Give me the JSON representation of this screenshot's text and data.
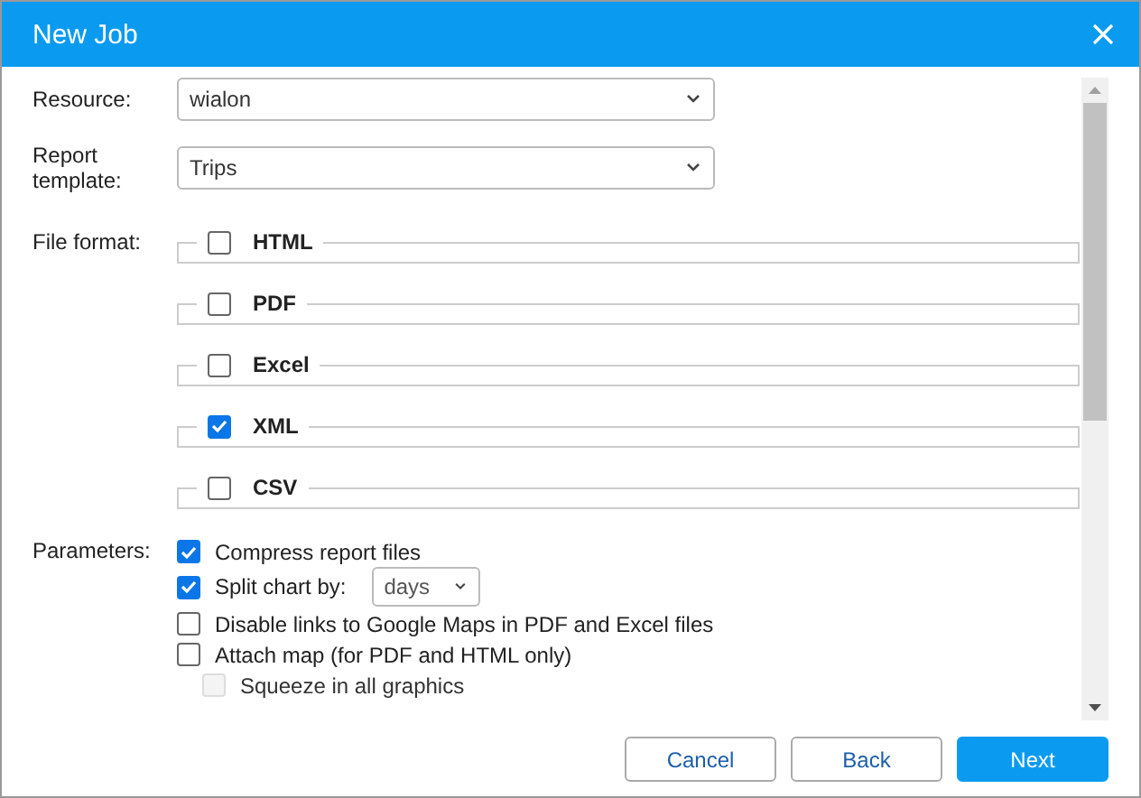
{
  "window": {
    "title": "New Job"
  },
  "resource": {
    "label": "Resource:",
    "value": "wialon"
  },
  "report_template": {
    "label": "Report template:",
    "value": "Trips"
  },
  "file_format": {
    "label": "File format:",
    "options": [
      {
        "label": "HTML",
        "checked": false
      },
      {
        "label": "PDF",
        "checked": false
      },
      {
        "label": "Excel",
        "checked": false
      },
      {
        "label": "XML",
        "checked": true
      },
      {
        "label": "CSV",
        "checked": false
      }
    ]
  },
  "parameters": {
    "label": "Parameters:",
    "items": [
      {
        "kind": "checkbox",
        "label": "Compress report files",
        "checked": true,
        "disabled": false
      },
      {
        "kind": "select",
        "label": "Split chart by:",
        "checked": true,
        "disabled": false,
        "value": "days"
      },
      {
        "kind": "checkbox",
        "label": "Disable links to Google Maps in PDF and Excel files",
        "checked": false,
        "disabled": false
      },
      {
        "kind": "checkbox",
        "label": "Attach map (for PDF and HTML only)",
        "checked": false,
        "disabled": false,
        "children": [
          {
            "kind": "checkbox",
            "label": "Squeeze in all graphics",
            "checked": false,
            "disabled": true
          }
        ]
      }
    ]
  },
  "buttons": [
    {
      "label": "Cancel",
      "kind": "secondary"
    },
    {
      "label": "Back",
      "kind": "secondary"
    },
    {
      "label": "Next",
      "kind": "primary"
    }
  ]
}
